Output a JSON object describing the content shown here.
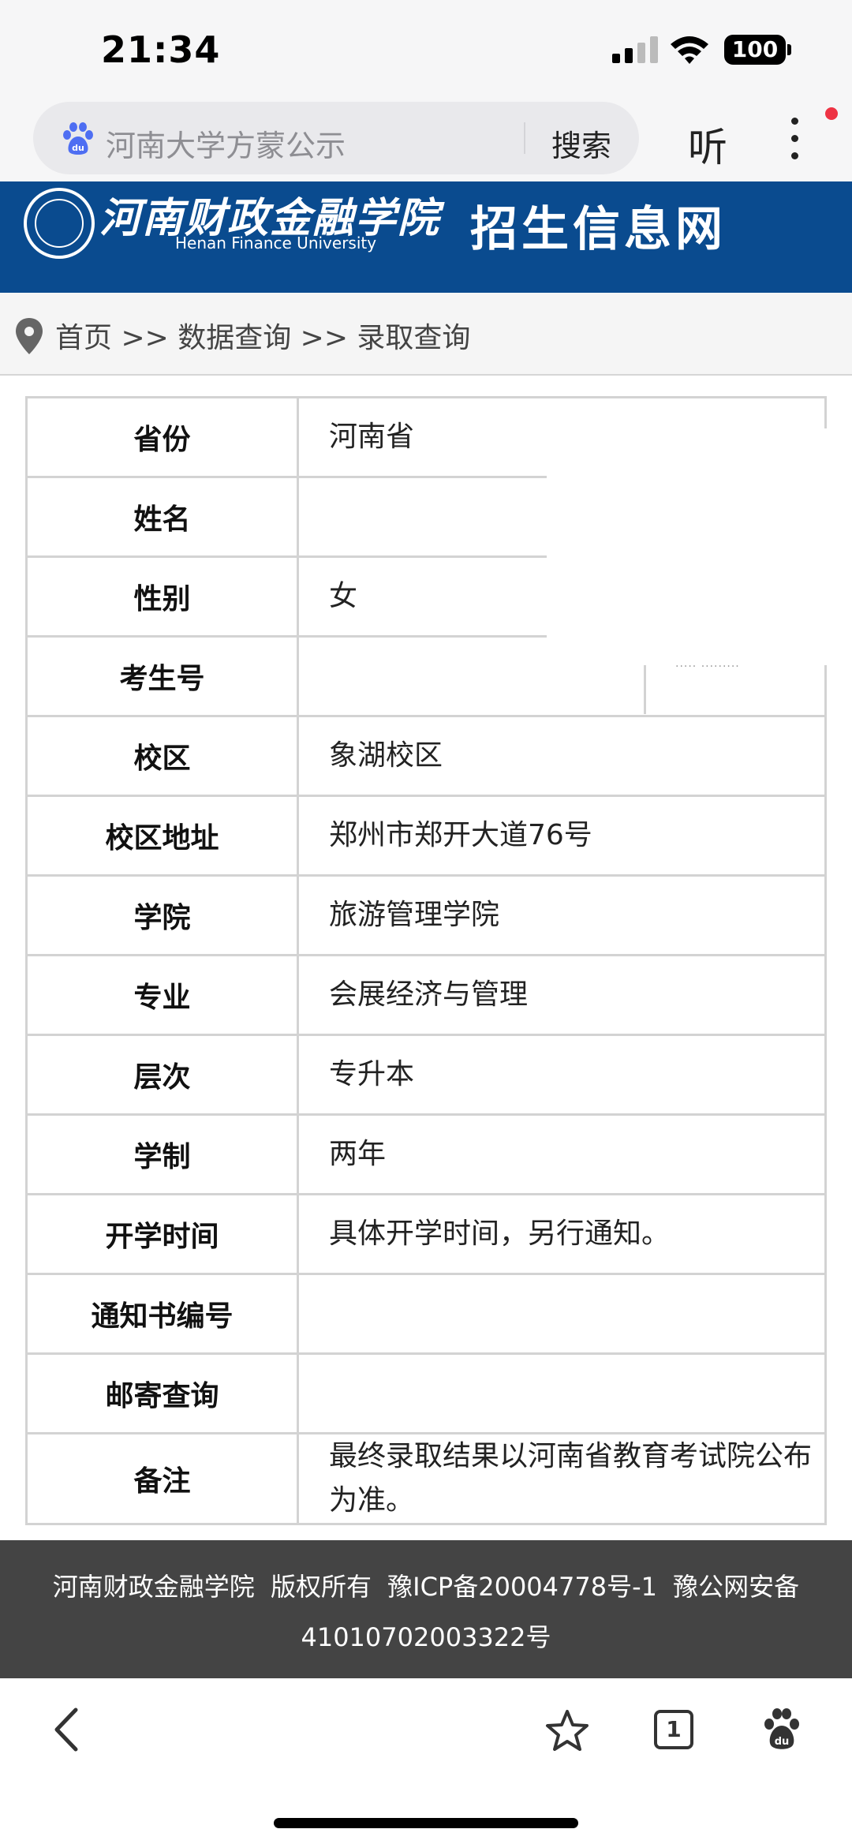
{
  "status_bar": {
    "time": "21:34",
    "battery": "100"
  },
  "browser": {
    "search_text": "河南大学方蒙公示",
    "search_button": "搜索",
    "listen_button": "听"
  },
  "site_header": {
    "school_name_cn": "河南财政金融学院",
    "school_name_en": "Henan Finance University",
    "subtitle": "招生信息网"
  },
  "breadcrumb": {
    "text": "首页 >> 数据查询 >> 录取查询"
  },
  "admission_table": {
    "rows": [
      {
        "label": "省份",
        "value": "河南省"
      },
      {
        "label": "姓名",
        "value": ""
      },
      {
        "label": "性别",
        "value": "女"
      },
      {
        "label": "考生号",
        "value": ""
      },
      {
        "label": "校区",
        "value": "象湖校区"
      },
      {
        "label": "校区地址",
        "value": "郑州市郑开大道76号"
      },
      {
        "label": "学院",
        "value": "旅游管理学院"
      },
      {
        "label": "专业",
        "value": "会展经济与管理"
      },
      {
        "label": "层次",
        "value": "专升本"
      },
      {
        "label": "学制",
        "value": "两年"
      },
      {
        "label": "开学时间",
        "value": "具体开学时间，另行通知。"
      },
      {
        "label": "通知书编号",
        "value": ""
      },
      {
        "label": "邮寄查询",
        "value": ""
      },
      {
        "label": "备注",
        "value": "最终录取结果以河南省教育考试院公布为准。"
      }
    ]
  },
  "footer": {
    "line1": "河南财政金融学院 版权所有 豫ICP备20004778号-1 豫公网安备",
    "line2": "41010702003322号"
  },
  "toolbar": {
    "tab_count": "1"
  },
  "colors": {
    "header_blue": "#0a4b8f",
    "footer_gray": "#444444",
    "notification_red": "#ee3344"
  }
}
